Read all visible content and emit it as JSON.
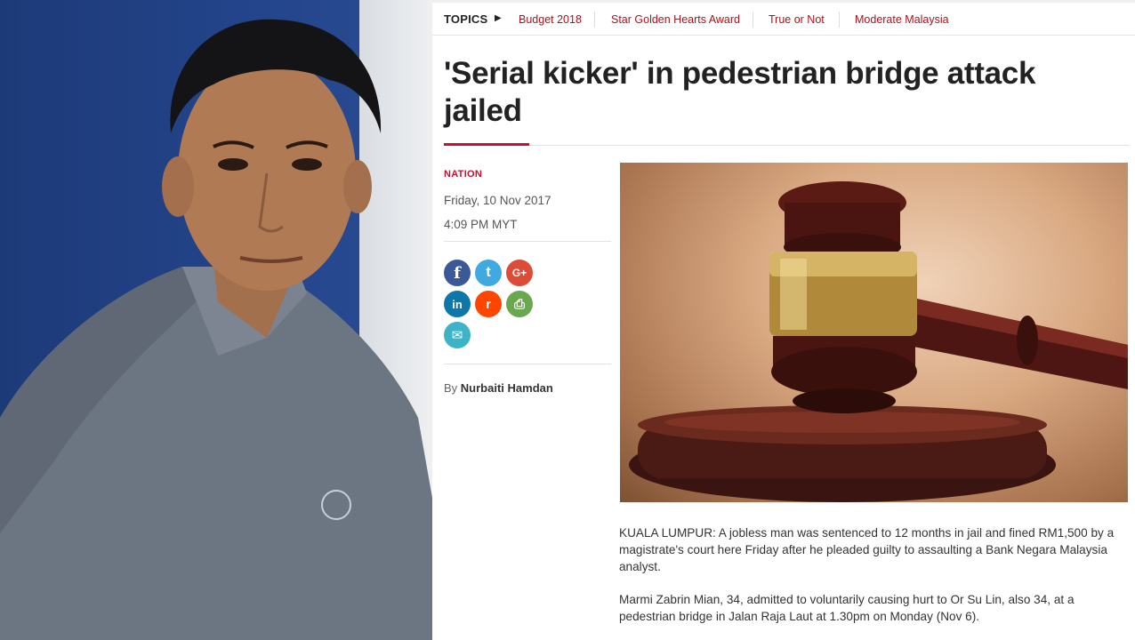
{
  "topics": {
    "label": "TOPICS",
    "items": [
      "Budget 2018",
      "Star Golden Hearts Award",
      "True or Not",
      "Moderate Malaysia"
    ]
  },
  "article": {
    "headline": "'Serial kicker' in pedestrian bridge attack jailed",
    "section": "NATION",
    "date": "Friday, 10 Nov 2017",
    "time": "4:09 PM MYT",
    "byline_prefix": "By",
    "author": "Nurbaiti Hamdan",
    "paragraphs": [
      "KUALA LUMPUR: A jobless man was sentenced to 12 months in jail and fined RM1,500 by a magistrate's court here Friday after he pleaded guilty to assaulting a Bank Negara Malaysia analyst.",
      "Marmi Zabrin Mian, 34, admitted to voluntarily causing hurt to Or Su Lin, also 34, at a pedestrian bridge in Jalan Raja Laut at 1.30pm on Monday (Nov 6)."
    ]
  },
  "share": {
    "buttons": [
      {
        "name": "facebook",
        "glyph": "f",
        "color": "#3b5998"
      },
      {
        "name": "twitter",
        "glyph": "t",
        "color": "#3fa9e0"
      },
      {
        "name": "google-plus",
        "glyph": "G+",
        "color": "#dd4b39"
      },
      {
        "name": "linkedin",
        "glyph": "in",
        "color": "#0e76a8"
      },
      {
        "name": "reddit",
        "glyph": "r",
        "color": "#ff4500"
      },
      {
        "name": "print",
        "glyph": "⎙",
        "color": "#6aa84f"
      },
      {
        "name": "email",
        "glyph": "✉",
        "color": "#3db3c7"
      }
    ]
  },
  "colors": {
    "accent": "#c8102e",
    "topic_link": "#b0111b",
    "headline": "#222222"
  }
}
